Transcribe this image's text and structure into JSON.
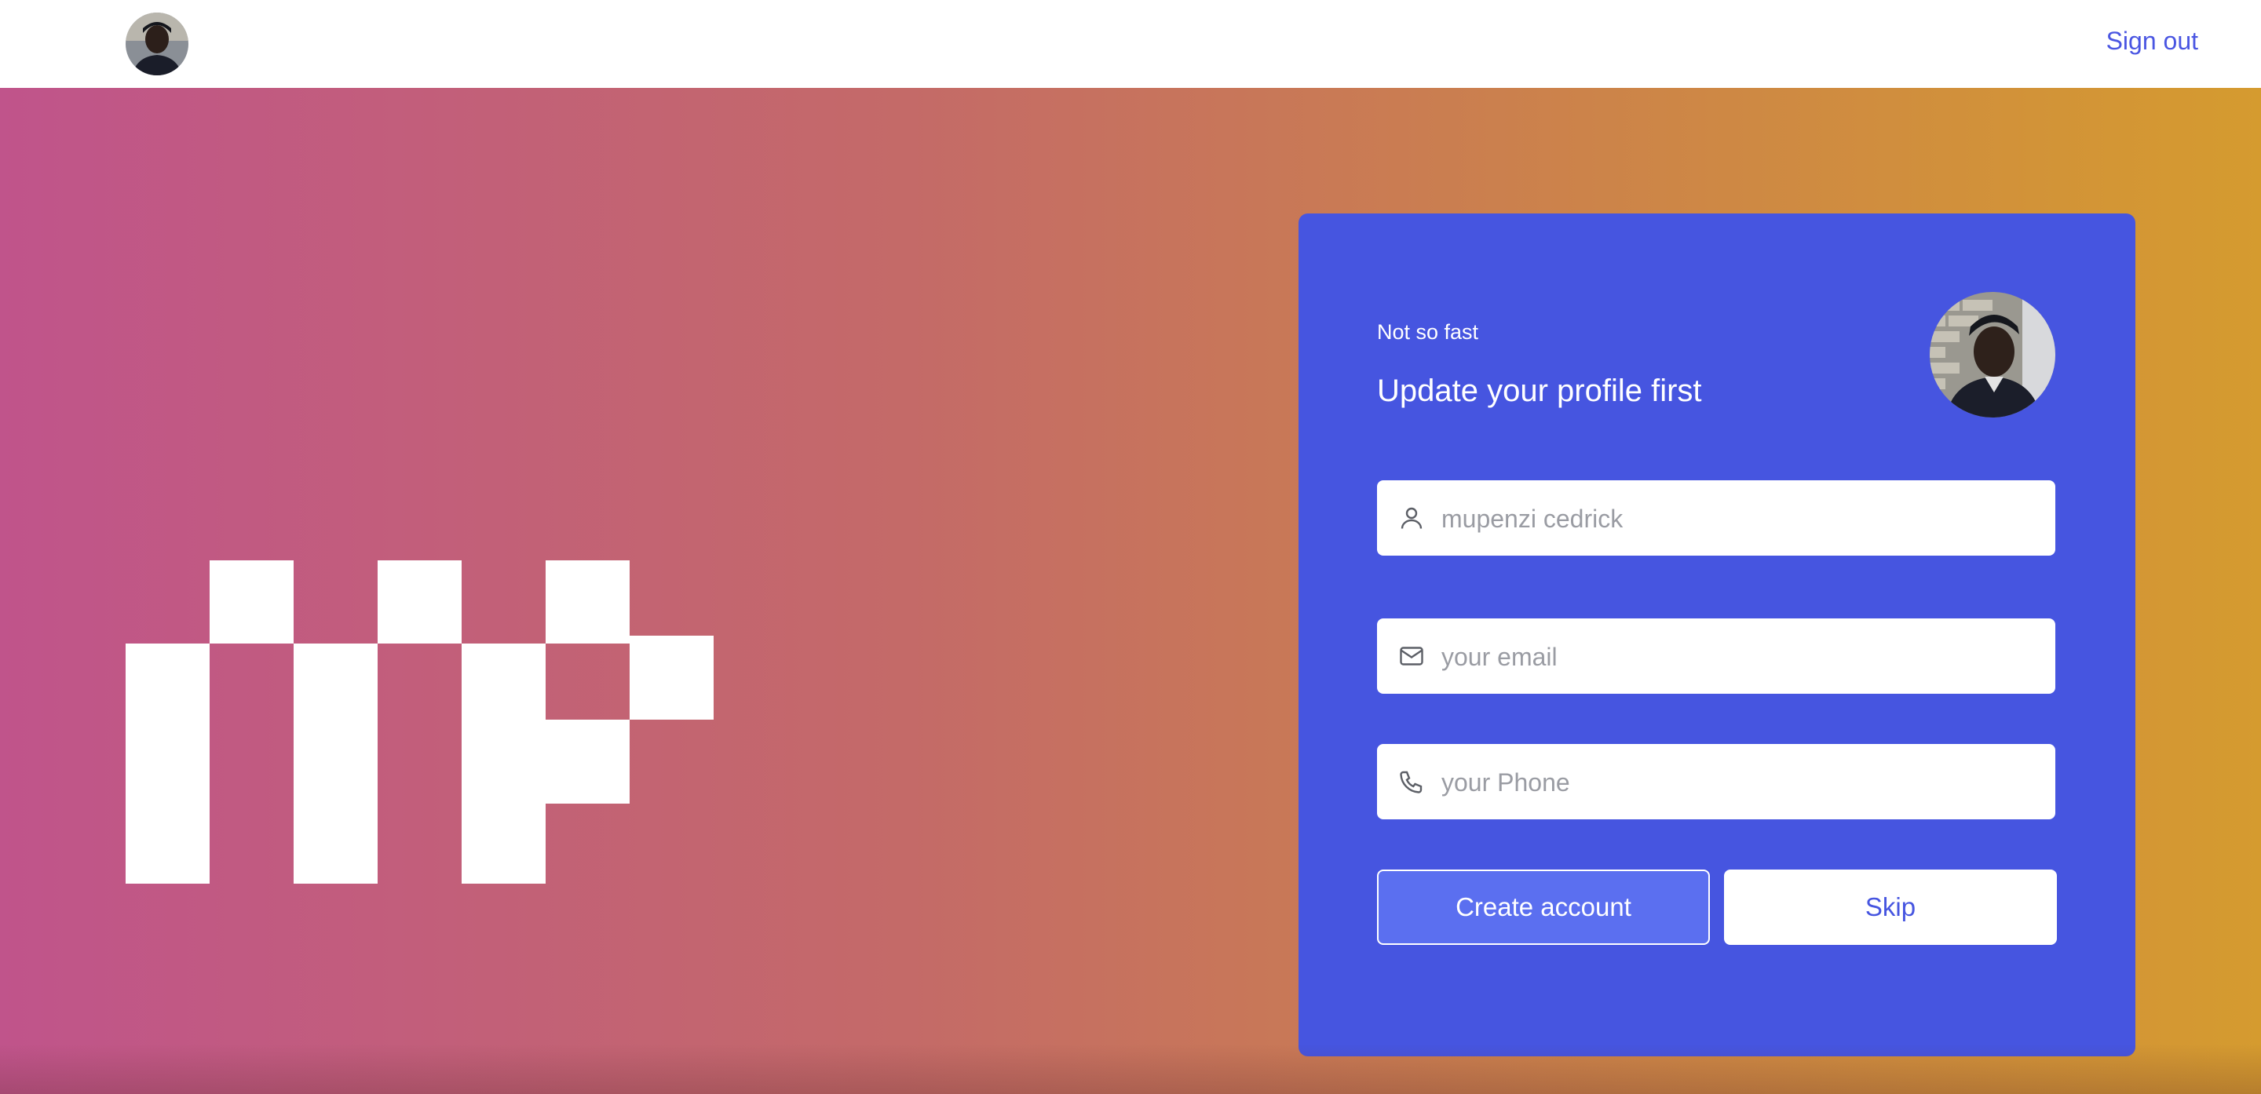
{
  "topbar": {
    "signout_label": "Sign out"
  },
  "profile_card": {
    "eyebrow": "Not so fast",
    "title": "Update your profile first",
    "fields": {
      "name": {
        "value": "",
        "placeholder": "mupenzi cedrick",
        "icon": "user-icon"
      },
      "email": {
        "value": "",
        "placeholder": "your email",
        "icon": "mail-icon"
      },
      "phone": {
        "value": "",
        "placeholder": "your Phone",
        "icon": "phone-icon"
      }
    },
    "create_label": "Create account",
    "skip_label": "Skip"
  },
  "colors": {
    "accent": "#4655e0",
    "link": "#4a56e2",
    "gradient_start": "#c0548b",
    "gradient_end": "#d59b2f"
  }
}
